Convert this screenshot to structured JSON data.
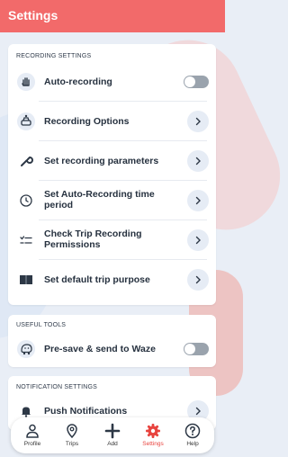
{
  "header": {
    "title": "Settings"
  },
  "colors": {
    "accent": "#f26a6a",
    "nav_active": "#e8443f"
  },
  "sections": {
    "recording": {
      "title": "RECORDING SETTINGS",
      "items": [
        {
          "label": "Auto-recording",
          "control": "toggle",
          "toggle_on": false,
          "icon": "hand-icon"
        },
        {
          "label": "Recording Options",
          "control": "chevron",
          "icon": "car-settings-icon"
        },
        {
          "label": "Set recording parameters",
          "control": "chevron",
          "icon": "wrench-icon"
        },
        {
          "label": "Set Auto-Recording time period",
          "control": "chevron",
          "icon": "clock-settings-icon"
        },
        {
          "label": "Check Trip Recording Permissions",
          "control": "chevron",
          "icon": "checklist-icon"
        },
        {
          "label": "Set default trip purpose",
          "control": "chevron",
          "icon": "book-icon"
        }
      ]
    },
    "tools": {
      "title": "USEFUL TOOLS",
      "items": [
        {
          "label": "Pre-save & send to Waze",
          "control": "toggle",
          "toggle_on": false,
          "icon": "waze-icon"
        }
      ]
    },
    "notifications": {
      "title": "NOTIFICATION SETTINGS",
      "items": [
        {
          "label": "Push Notifications",
          "control": "chevron",
          "icon": "bell-icon"
        }
      ]
    }
  },
  "nav": {
    "items": [
      {
        "label": "Profile",
        "icon": "person-icon",
        "active": false
      },
      {
        "label": "Trips",
        "icon": "map-pin-icon",
        "active": false
      },
      {
        "label": "Add",
        "icon": "plus-icon",
        "active": false
      },
      {
        "label": "Settings",
        "icon": "gear-icon",
        "active": true
      },
      {
        "label": "Help",
        "icon": "help-icon",
        "active": false
      }
    ]
  }
}
